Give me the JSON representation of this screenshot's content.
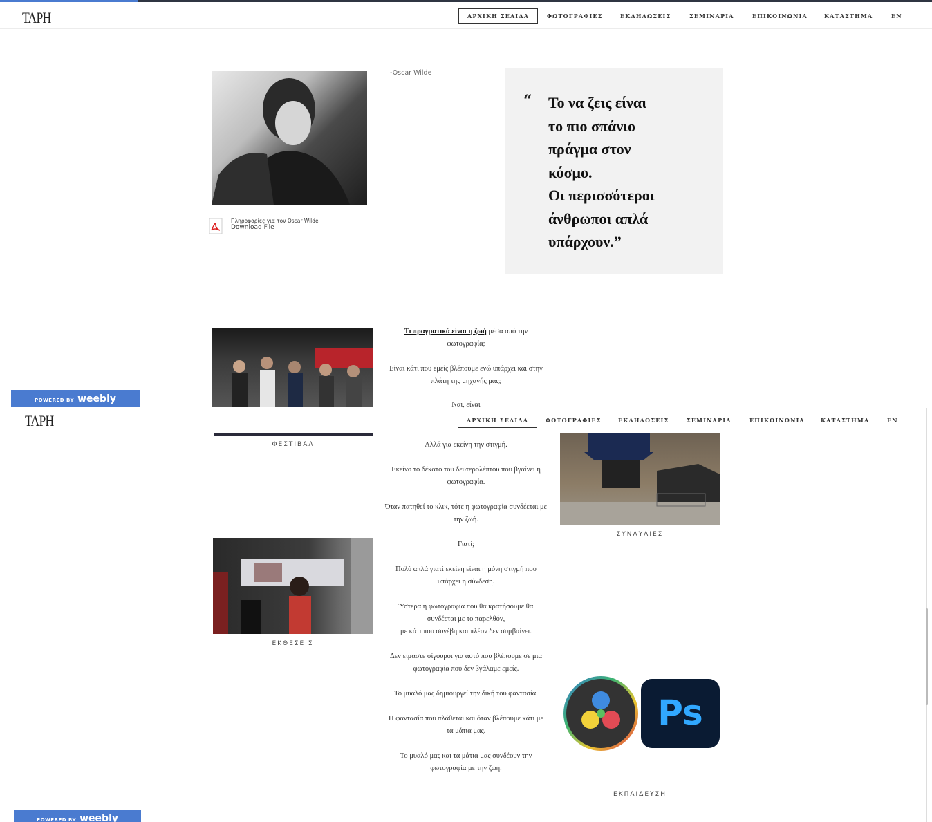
{
  "nav": {
    "logo": "ΤΑΡΗ",
    "items": [
      "ΑΡΧΙΚΗ ΣΕΛΙΔΑ",
      "ΦΩΤΟΓΡΑΦΙΕΣ",
      "ΕΚΔΗΛΩΣΕΙΣ",
      "ΣΕΜΙΝΑΡΙΑ",
      "ΕΠΙΚΟΙΝΩΝΙΑ",
      "ΚΑΤΑΣΤΗΜΑ",
      "EN"
    ]
  },
  "quote": {
    "author": "-Oscar Wilde",
    "mark": "“",
    "lines": [
      "Το να ζεις είναι",
      "το πιο σπάνιο",
      "πράγμα στον",
      "κόσμο.",
      "Οι περισσότεροι",
      "άνθρωποι απλά",
      "υπάρχουν.”"
    ]
  },
  "file": {
    "title": "Πληροφορίες για τον Oscar Wilde",
    "link": "Download File"
  },
  "captions": {
    "festival": "ΦΕΣΤΙΒΑΛ",
    "concerts": "ΣΥΝΑΥΛΙΕΣ",
    "exhibitions": "ΕΚΘΕΣΕΙΣ",
    "education": "ΕΚΠΑΙΔΕΥΣΗ"
  },
  "text_top": {
    "p1_link": "Τι πραγματικά είναι η ζωή",
    "p1_rest": " μέσα από την φωτογραφία;",
    "p2": "Είναι κάτι που εμείς βλέπουμε ενώ υπάρχει και στην πλάτη της μηχανής μας;",
    "p3": "Ναι, είναι"
  },
  "text_bottom": [
    "Αλλά για εκείνη την στιγμή.",
    "Εκείνο το δέκατο του δευτερολέπτου που βγαίνει η φωτογραφία.",
    "Όταν πατηθεί το κλικ, τότε η φωτογραφία συνδέεται με την ζωή.",
    "Γιατί;",
    "Πολύ απλά γιατί εκείνη είναι η μόνη στιγμή που υπάρχει η σύνδεση.",
    "Ύστερα η φωτογραφία που θα κρατήσουμε θα συνδέεται με το παρελθόν,",
    "με κάτι που συνέβη και πλέον δεν συμβαίνει.",
    "Δεν είμαστε σίγουροι για αυτό που βλέπουμε σε μια φωτογραφία που δεν βγάλαμε εμείς.",
    "Το μυαλό μας δημιουργεί την δική του φαντασία.",
    "Η φαντασία που πλάθεται και όταν βλέπουμε κάτι με τα μάτια μας.",
    "Το μυαλό μας και τα μάτια μας συνδέουν την φωτογραφία με την ζωή."
  ],
  "weebly": {
    "powered": "POWERED BY",
    "brand": "weebly"
  },
  "logos": {
    "ps": "Ps"
  },
  "icons": [
    "pdf-icon",
    "davinci-resolve-icon",
    "photoshop-icon"
  ]
}
